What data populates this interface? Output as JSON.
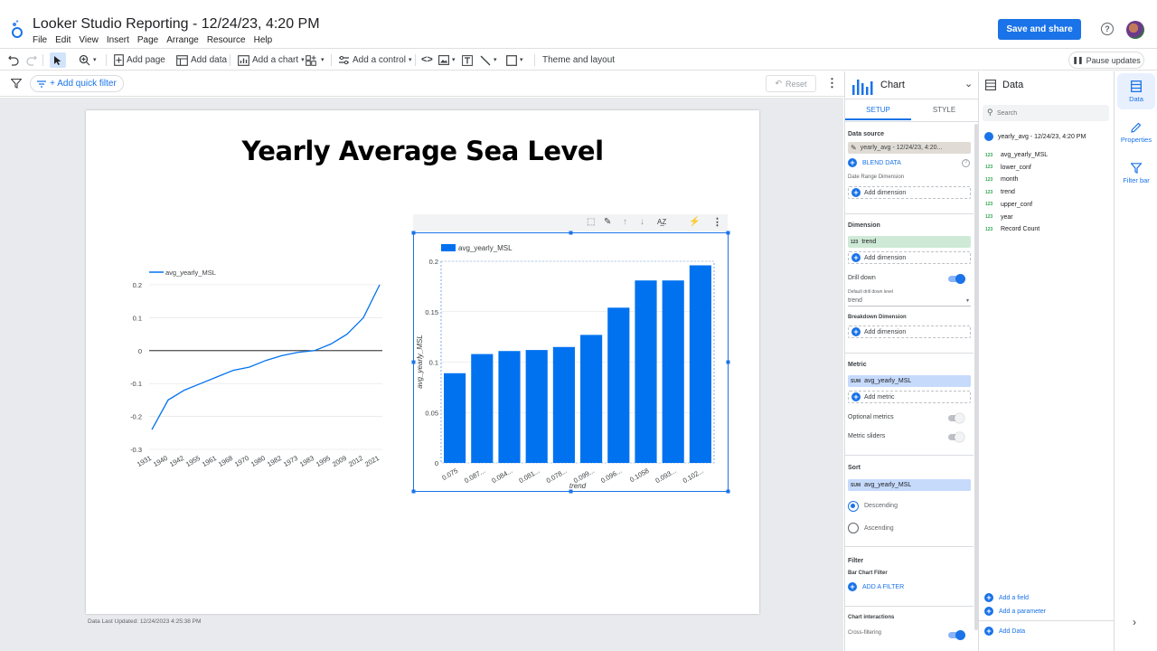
{
  "header": {
    "title": "Looker Studio Reporting - 12/24/23, 4:20 PM",
    "menus": [
      "File",
      "Edit",
      "View",
      "Insert",
      "Page",
      "Arrange",
      "Resource",
      "Help"
    ],
    "save_share": "Save and share"
  },
  "toolbar": {
    "add_page": "Add page",
    "add_data": "Add data",
    "add_chart": "Add a chart",
    "add_control": "Add a control",
    "theme_layout": "Theme and layout",
    "pause_updates": "Pause updates"
  },
  "filterbar": {
    "quick_filter": "+ Add quick filter",
    "reset": "Reset"
  },
  "report": {
    "title": "Yearly Average Sea Level",
    "data_updated": "Data Last Updated: 12/24/2023 4:25:38 PM"
  },
  "colors": {
    "accent": "#1a73e8",
    "bar": "#0072f0"
  },
  "chart_data": [
    {
      "type": "line",
      "legend": "avg_yearly_MSL",
      "x": [
        "1931",
        "1940",
        "1942",
        "1955",
        "1961",
        "1968",
        "1970",
        "1980",
        "1982",
        "1973",
        "1983",
        "1995",
        "2009",
        "2012",
        "2021"
      ],
      "values": [
        -0.24,
        -0.15,
        -0.12,
        -0.1,
        -0.08,
        -0.06,
        -0.05,
        -0.03,
        -0.015,
        -0.005,
        0.0,
        0.02,
        0.05,
        0.1,
        0.2
      ],
      "ylim": [
        -0.3,
        0.2
      ],
      "yticks": [
        "0.2",
        "0.1",
        "0",
        "-0.1",
        "-0.2",
        "-0.3"
      ]
    },
    {
      "type": "bar",
      "legend": "avg_yearly_MSL",
      "xlabel": "trend",
      "ylabel": "avg_yearly_MSL",
      "categories": [
        "0.075",
        "0.087...",
        "0.084...",
        "0.081...",
        "0.078...",
        "0.099...",
        "0.096...",
        "0.1058",
        "0.093...",
        "0.102..."
      ],
      "values": [
        0.089,
        0.108,
        0.111,
        0.112,
        0.115,
        0.127,
        0.154,
        0.181,
        0.181,
        0.196
      ],
      "ylim": [
        0,
        0.2
      ],
      "yticks": [
        "0.2",
        "0.15",
        "0.1",
        "0.05",
        "0"
      ]
    }
  ],
  "chart_panel": {
    "title": "Chart",
    "tab_setup": "SETUP",
    "tab_style": "STYLE",
    "data_source_label": "Data source",
    "data_source": "yearly_avg - 12/24/23, 4:20...",
    "blend": "BLEND DATA",
    "date_range_label": "Date Range Dimension",
    "add_dimension": "Add dimension",
    "dimension_label": "Dimension",
    "dimension_value": "trend",
    "drill_down": "Drill down",
    "drill_default_label": "Default drill down level",
    "drill_default_value": "trend",
    "breakdown_label": "Breakdown Dimension",
    "metric_label": "Metric",
    "metric_value": "avg_yearly_MSL",
    "add_metric": "Add metric",
    "optional_metrics": "Optional metrics",
    "metric_sliders": "Metric sliders",
    "sort_label": "Sort",
    "sort_value": "avg_yearly_MSL",
    "descending": "Descending",
    "ascending": "Ascending",
    "filter_label": "Filter",
    "bar_filter_label": "Bar Chart Filter",
    "add_filter": "ADD A FILTER",
    "interactions_label": "Chart interactions",
    "cross_filtering": "Cross-filtering",
    "num_badge": "123",
    "sum_badge": "SUM"
  },
  "data_panel": {
    "title": "Data",
    "search_placeholder": "Search",
    "source": "yearly_avg - 12/24/23, 4:20 PM",
    "fields": [
      "avg_yearly_MSL",
      "lower_conf",
      "month",
      "trend",
      "upper_conf",
      "year",
      "Record Count"
    ],
    "num_badge": "123",
    "add_field": "Add a field",
    "add_parameter": "Add a parameter",
    "add_data": "Add Data"
  },
  "side_rail": {
    "data": "Data",
    "properties": "Properties",
    "filter_bar": "Filter bar"
  }
}
